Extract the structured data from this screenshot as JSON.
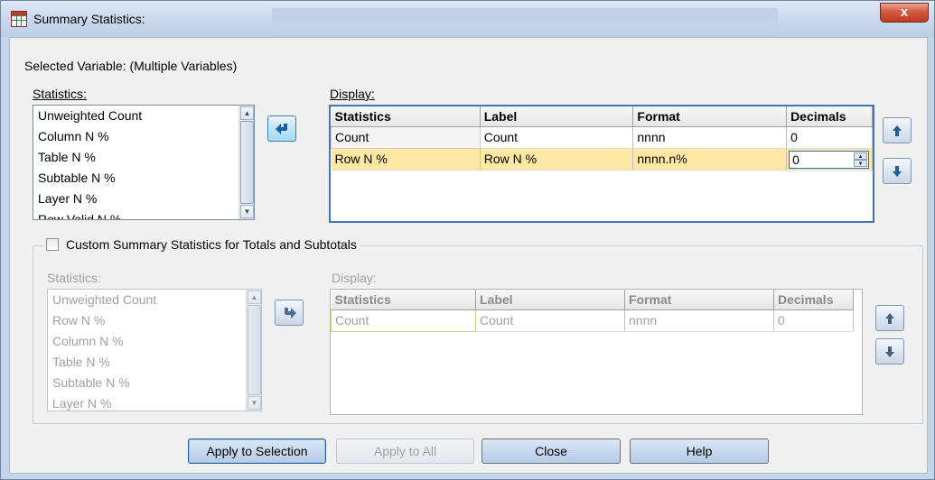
{
  "window": {
    "title": "Summary Statistics:",
    "close_label": "x"
  },
  "selected_variable": "Selected Variable: (Multiple Variables)",
  "top": {
    "statistics_label": "Statistics:",
    "display_label": "Display:",
    "statistics_items": [
      "Unweighted Count",
      "Column N %",
      "Table N %",
      "Subtable N %",
      "Layer N %",
      "Row Valid N %"
    ],
    "columns": [
      "Statistics",
      "Label",
      "Format",
      "Decimals"
    ],
    "rows": [
      {
        "statistics": "Count",
        "label": "Count",
        "format": "nnnn",
        "decimals": "0"
      },
      {
        "statistics": "Row N %",
        "label": "Row N %",
        "format": "nnnn.n%",
        "decimals": "0"
      }
    ]
  },
  "custom": {
    "checkbox_label": "Custom Summary Statistics for Totals and Subtotals",
    "checked": false,
    "statistics_label": "Statistics:",
    "display_label": "Display:",
    "statistics_items": [
      "Unweighted Count",
      "Row N %",
      "Column N %",
      "Table N %",
      "Subtable N %",
      "Layer N %"
    ],
    "columns": [
      "Statistics",
      "Label",
      "Format",
      "Decimals"
    ],
    "rows": [
      {
        "statistics": "Count",
        "label": "Count",
        "format": "nnnn",
        "decimals": "0"
      }
    ]
  },
  "buttons": {
    "apply_selection": "Apply to Selection",
    "apply_all": "Apply to All",
    "close": "Close",
    "help": "Help"
  },
  "colors": {
    "selected_row": "#ffe8a4",
    "focus_border": "#3f78b5"
  }
}
